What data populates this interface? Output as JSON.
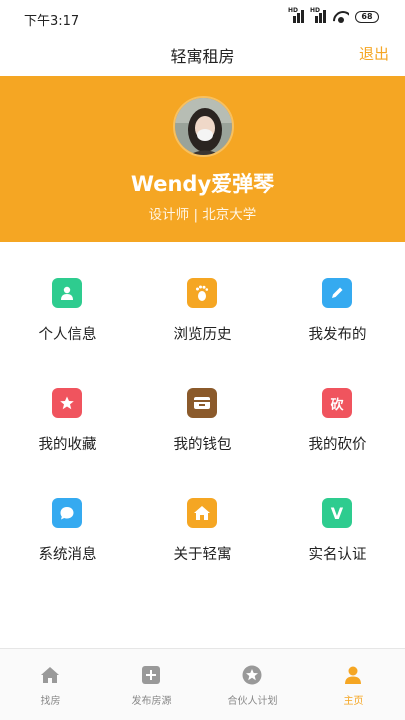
{
  "status_bar": {
    "time": "下午3:17",
    "battery": "68"
  },
  "header": {
    "title": "轻寓租房",
    "logout": "退出"
  },
  "profile": {
    "name": "Wendy爱弹琴",
    "description": "设计师 | 北京大学"
  },
  "menu": [
    {
      "label": "个人信息",
      "icon": "person-icon",
      "color": "#2ecc8f"
    },
    {
      "label": "浏览历史",
      "icon": "footprint-icon",
      "color": "#f5a623"
    },
    {
      "label": "我发布的",
      "icon": "pencil-icon",
      "color": "#35aaf0"
    },
    {
      "label": "我的收藏",
      "icon": "star-icon",
      "color": "#f0545e"
    },
    {
      "label": "我的钱包",
      "icon": "wallet-icon",
      "color": "#8b5a2b"
    },
    {
      "label": "我的砍价",
      "icon": "bargain-icon",
      "color": "#f0545e",
      "glyph": "砍"
    },
    {
      "label": "系统消息",
      "icon": "message-icon",
      "color": "#35aaf0"
    },
    {
      "label": "关于轻寓",
      "icon": "house-icon",
      "color": "#f5a623"
    },
    {
      "label": "实名认证",
      "icon": "verify-icon",
      "color": "#2ecc8f",
      "glyph": "V"
    }
  ],
  "tabs": [
    {
      "label": "找房",
      "icon": "home-icon"
    },
    {
      "label": "发布房源",
      "icon": "plus-icon"
    },
    {
      "label": "合伙人计划",
      "icon": "partner-star-icon"
    },
    {
      "label": "主页",
      "icon": "user-icon",
      "active": true
    }
  ],
  "colors": {
    "accent": "#f5a623",
    "inactive_tab": "#888888"
  }
}
